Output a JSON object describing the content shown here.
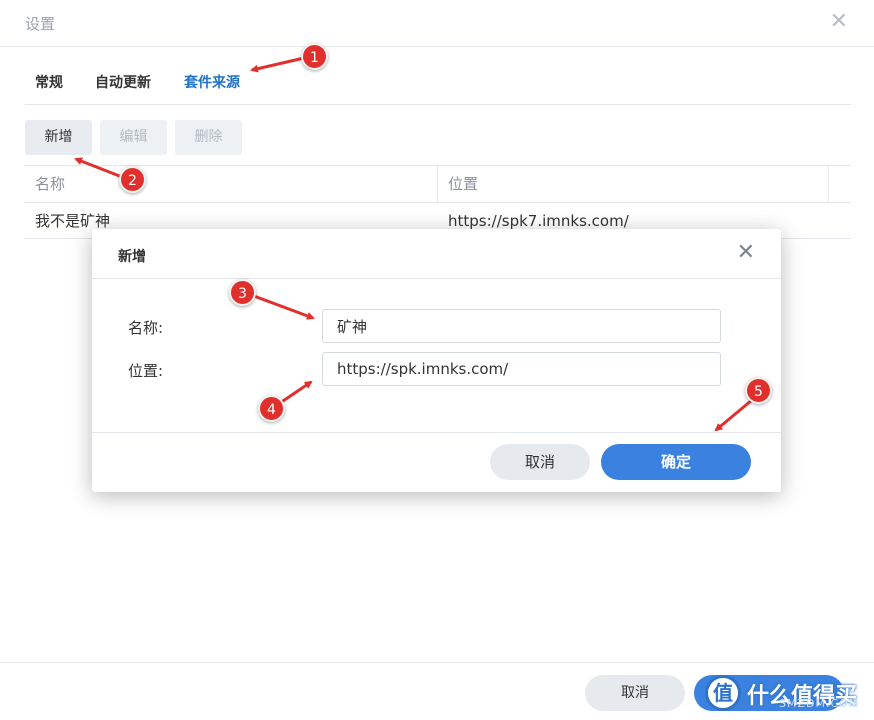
{
  "window": {
    "title": "设置",
    "close_glyph": "✕"
  },
  "tabs": [
    {
      "label": "常规",
      "active": false
    },
    {
      "label": "自动更新",
      "active": false
    },
    {
      "label": "套件来源",
      "active": true
    }
  ],
  "toolbar": {
    "add_label": "新增",
    "edit_label": "编辑",
    "delete_label": "删除"
  },
  "grid": {
    "columns": [
      "名称",
      "位置"
    ],
    "rows": [
      {
        "name": "我不是矿神",
        "location": "https://spk7.imnks.com/"
      }
    ]
  },
  "dialog": {
    "title": "新增",
    "close_glyph": "✕",
    "name_label": "名称:",
    "name_value": "矿神",
    "location_label": "位置:",
    "location_value": "https://spk.imnks.com/",
    "cancel_label": "取消",
    "ok_label": "确定"
  },
  "footer": {
    "cancel_label": "取消"
  },
  "markers": [
    "1",
    "2",
    "3",
    "4",
    "5"
  ],
  "watermark": {
    "glyph": "值",
    "text": "什么值得买",
    "sub": "SMZDM.COM"
  },
  "colors": {
    "accent": "#3b82e0",
    "active_tab": "#1f72c6",
    "marker": "#e1302b"
  }
}
